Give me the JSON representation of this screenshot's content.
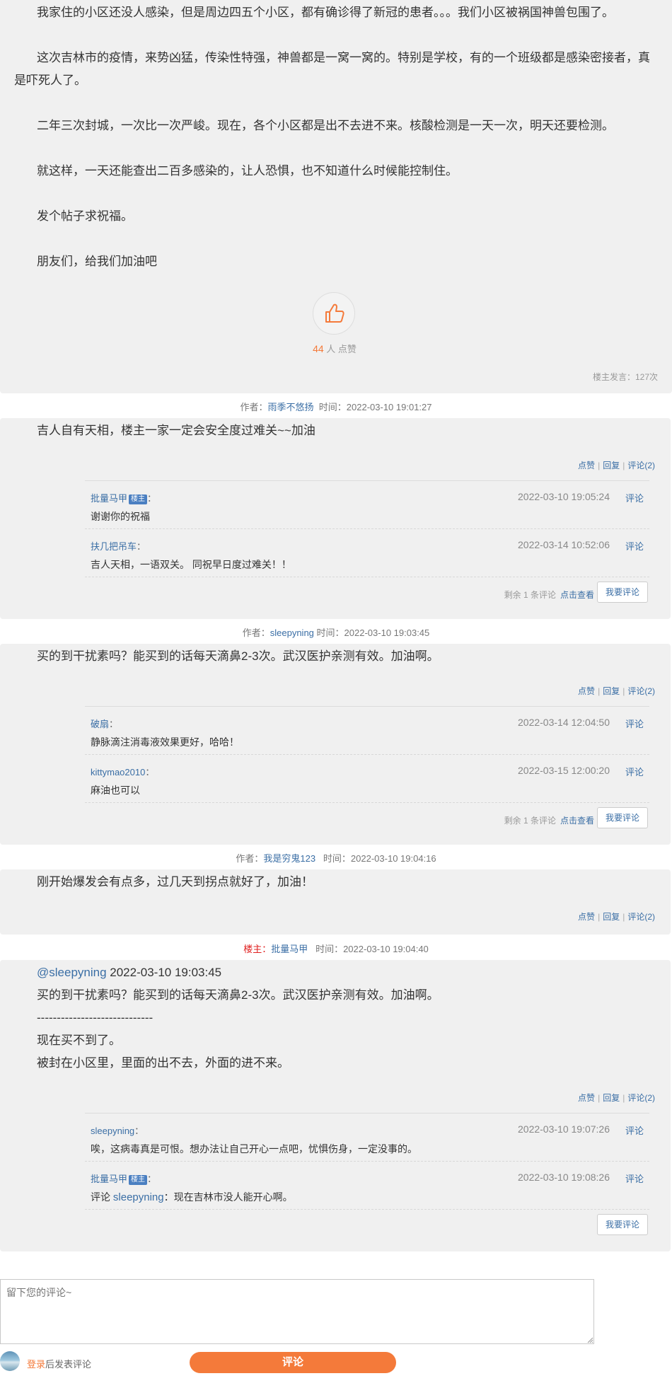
{
  "post": {
    "paragraphs": [
      "我家住的小区还没人感染，但是周边四五个小区，都有确诊得了新冠的患者。。。我们小区被祸国神兽包围了。",
      "这次吉林市的疫情，来势凶猛，传染性特强，神兽都是一窝一窝的。特别是学校，有的一个班级都是感染密接者，真是吓死人了。",
      "二年三次封城，一次比一次严峻。现在，各个小区都是出不去进不来。核酸检测是一天一次，明天还要检测。",
      "就这样，一天还能查出二百多感染的，让人恐惧，也不知道什么时候能控制住。",
      "发个帖子求祝福。",
      "朋友们，给我们加油吧"
    ],
    "like_count": "44",
    "like_suffix": " 人 点赞",
    "host_stat": "楼主发言：127次"
  },
  "labels": {
    "author_prefix": "作者：",
    "time_prefix": "时间：",
    "host_prefix": "楼主：",
    "like": "点赞",
    "reply": "回复",
    "comments": "评论(2)",
    "comment": "评论",
    "colon": "：",
    "host_badge": "楼主",
    "remaining": "剩余 1 条评论",
    "click_view": "点击查看",
    "write_comment": "我要评论",
    "quote_comment_prefix": "评论 "
  },
  "replies": [
    {
      "author": "雨季不悠扬",
      "time": "2022-03-10 19:01:27",
      "text": "吉人自有天相，楼主一家一定会安全度过难关~~加油",
      "subs": [
        {
          "user": "批量马甲",
          "time": "2022-03-10 19:05:24",
          "text": "谢谢你的祝福"
        },
        {
          "user": "扶几把吊车",
          "time": "2022-03-14 10:52:06",
          "text": "吉人天相，一语双关。 同祝早日度过难关！！"
        }
      ]
    },
    {
      "author": "sleepyning",
      "time": "2022-03-10 19:03:45",
      "text": "买的到干扰素吗？能买到的话每天滴鼻2-3次。武汉医护亲测有效。加油啊。",
      "subs": [
        {
          "user": "破扇",
          "time": "2022-03-14 12:04:50",
          "text": "静脉滴注消毒液效果更好，哈哈！"
        },
        {
          "user": "kittymao2010",
          "time": "2022-03-15 12:00:20",
          "text": "麻油也可以"
        }
      ]
    },
    {
      "author": "我是穷鬼123",
      "time": "2022-03-10 19:04:16",
      "text": "刚开始爆发会有点多，过几天到拐点就好了，加油！"
    },
    {
      "author": "批量马甲",
      "time": "2022-03-10 19:04:40",
      "quote_user": "@sleepyning",
      "quote_time": " 2022-03-10 19:03:45",
      "quote_text": "买的到干扰素吗？能买到的话每天滴鼻2-3次。武汉医护亲测有效。加油啊。",
      "divider": "-----------------------------",
      "lines": [
        "现在买不到了。",
        "被封在小区里，里面的出不去，外面的进不来。"
      ],
      "subs": [
        {
          "user": "sleepyning",
          "time": "2022-03-10 19:07:26",
          "text": "唉，这病毒真是可恨。想办法让自己开心一点吧，忧惧伤身，一定没事的。"
        },
        {
          "user": "批量马甲",
          "time": "2022-03-10 19:08:26",
          "quote_user": "sleepyning",
          "text": "：现在吉林市没人能开心啊。"
        }
      ]
    }
  ],
  "composer": {
    "placeholder": "留下您的评论~",
    "login_link": "登录",
    "login_suffix": "后发表评论",
    "submit": "评论"
  },
  "colors": {
    "accent": "#f47a3a",
    "link": "#3a6ea5",
    "block_bg": "#f0f0f0",
    "host_red": "#e02020"
  }
}
